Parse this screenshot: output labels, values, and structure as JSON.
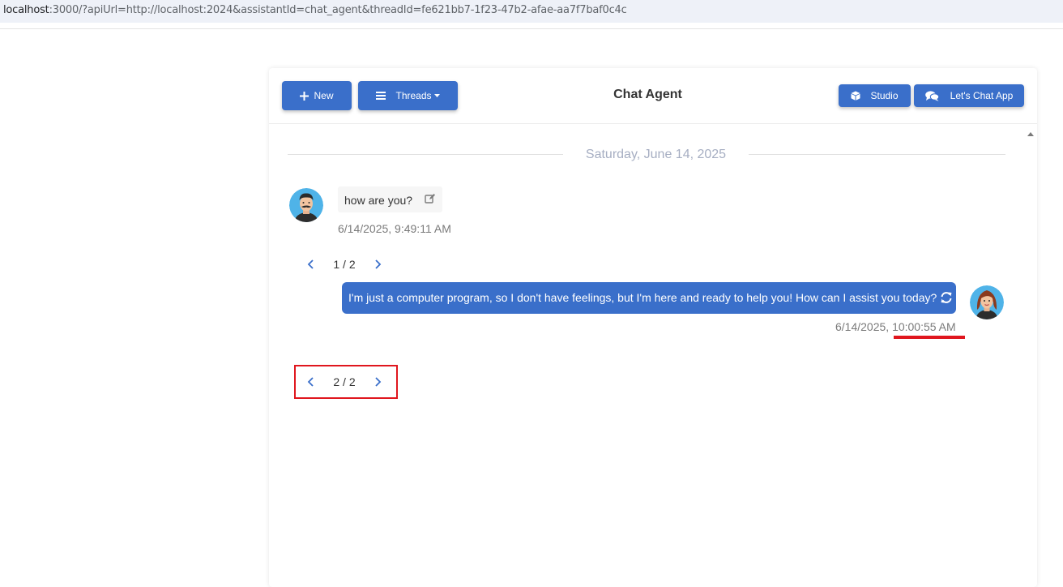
{
  "browser": {
    "url_host": "localhost",
    "url_rest": ":3000/?apiUrl=http://localhost:2024&assistantId=chat_agent&threadId=fe621bb7-1f23-47b2-afae-aa7f7baf0c4c"
  },
  "header": {
    "new_label": "New",
    "threads_label": "Threads",
    "title": "Chat Agent",
    "studio_label": "Studio",
    "letschat_label": "Let's Chat App"
  },
  "chat": {
    "date_separator": "Saturday, June 14, 2025",
    "messages": [
      {
        "role": "user",
        "text": "how are you?",
        "timestamp": "6/14/2025, 9:49:11 AM",
        "avatar_icon": "man-avatar-icon",
        "action_icon": "edit-icon"
      },
      {
        "role": "assistant",
        "text": "I'm just a computer program, so I don't have feelings, but I'm here and ready to help you! How can I assist you today?",
        "timestamp_date": "6/14/2025, ",
        "timestamp_time": "10:00:55 AM",
        "avatar_icon": "woman-avatar-icon",
        "action_icon": "regenerate-icon"
      }
    ],
    "pagers": [
      {
        "label": "1 / 2"
      },
      {
        "label": "2 / 2"
      }
    ]
  },
  "colors": {
    "accent": "#3a6fca",
    "highlight": "#e0161e",
    "date_text": "#a6aec2"
  }
}
